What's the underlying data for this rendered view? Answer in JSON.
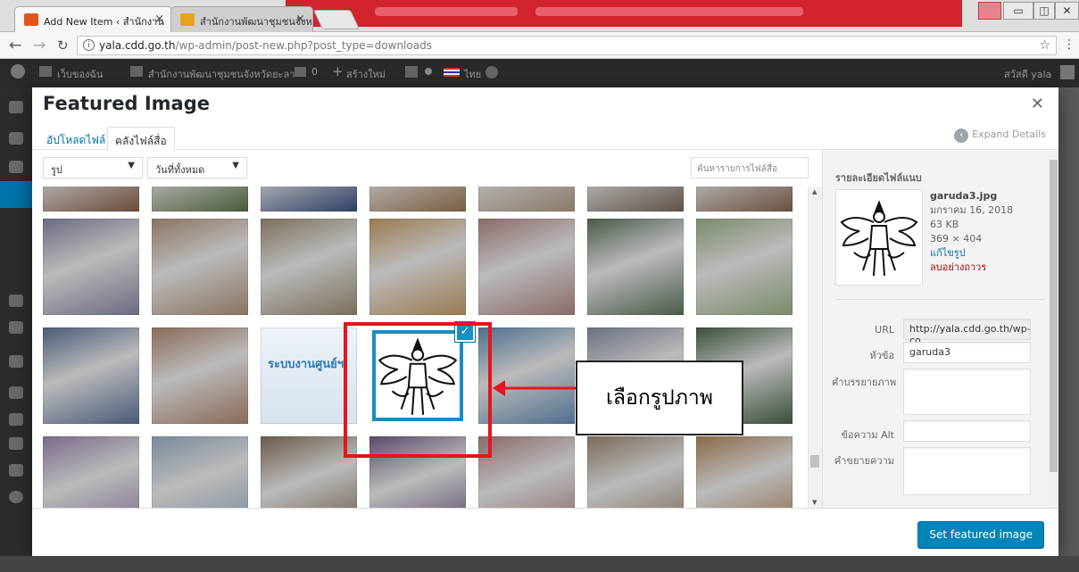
{
  "browser": {
    "tabs": [
      {
        "title": "Add New Item ‹ สำนักงาน",
        "favicon_color": "#e2561e"
      },
      {
        "title": "สำนักงานพัฒนาชุมชนจังหวัด",
        "favicon_color": "#e8a31c"
      }
    ],
    "url_host": "yala.cdd.go.th",
    "url_path": "/wp-admin/post-new.php?post_type=downloads",
    "title_bar_color": "#d2232f"
  },
  "admin_bar": {
    "my_sites": "เว็บของฉัน",
    "site_name": "สำนักงานพัฒนาชุมชนจังหวัดยะลา",
    "comments_count": "0",
    "new_content": "สร้างใหม่",
    "language": "ไทย",
    "greeting": "สวัสดี yala"
  },
  "modal": {
    "title": "Featured Image",
    "close_icon": "close-icon",
    "tabs": {
      "upload": "อัปโหลดไฟล์",
      "library": "คลังไฟล์สื่อ"
    },
    "expand_details": "Expand Details",
    "filters": {
      "type_selected": "รูป",
      "date_selected": "วันที่ทั้งหมด"
    },
    "search_placeholder": "ค้นหารายการไฟล์สื่อ",
    "button": "Set featured image"
  },
  "attachment_details": {
    "heading": "รายละเอียดไฟล์แนบ",
    "filename": "garuda3.jpg",
    "date": "มกราคม 16, 2018",
    "size": "63 KB",
    "dimensions": "369 × 404",
    "edit_link": "แก้ไขรูป",
    "delete_link": "ลบอย่างถาวร",
    "fields": {
      "url_label": "URL",
      "url_value": "http://yala.cdd.go.th/wp-co",
      "title_label": "หัวข้อ",
      "title_value": "garuda3",
      "caption_label": "คำบรรยายภาพ",
      "alt_label": "ข้อความ Alt",
      "description_label": "คำขยายความ"
    }
  },
  "annotation": {
    "callout_text": "เลือกรูปภาพ",
    "color": "#e8141c"
  },
  "grid_colors": {
    "row0": [
      "#6b4b3a",
      "#4a5a38",
      "#2f3f66",
      "#7a5d40",
      "#8a7a6a",
      "#5f5248",
      "#6a5040"
    ],
    "row1": [
      "#6a6b80",
      "#8a7462",
      "#7a6f5c",
      "#9a7a50",
      "#8a6b6a",
      "#4a5a4a",
      "#7a8a6a"
    ],
    "row2": [
      "#4a5a78",
      "#8a6a58",
      "#dde6ee",
      "#ffffff",
      "#4e6f8e",
      "#6a7080",
      "#3a4e3a"
    ],
    "row3": [
      "#7a6a8a",
      "#7a8a9a",
      "#6a5a4a",
      "#5a4a6a",
      "#8a6a6a",
      "#7a6a5a",
      "#8a6a4a"
    ]
  },
  "banner_text": "ระบบงานศูนย์ฯ"
}
